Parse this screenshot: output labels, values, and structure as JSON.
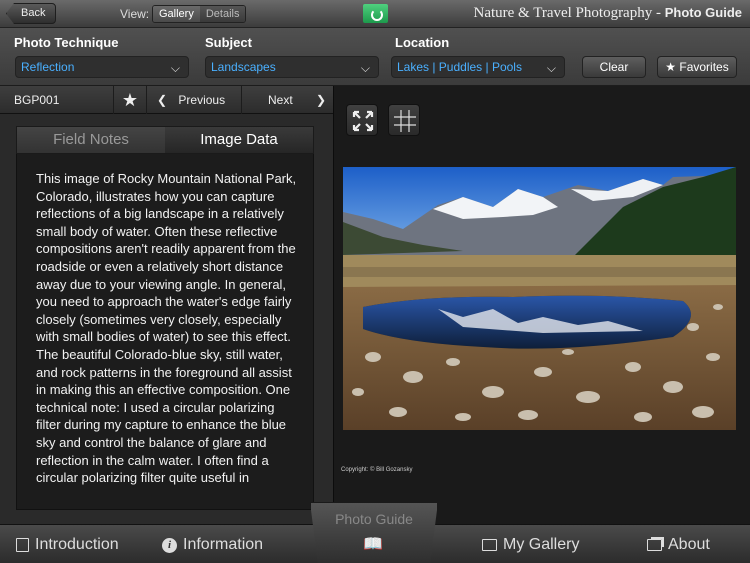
{
  "topbar": {
    "back_label": "Back",
    "view_label": "View:",
    "view_options": [
      "Gallery",
      "Details"
    ],
    "app_title": "Nature & Travel Photography -",
    "app_title_bold": "Photo Guide"
  },
  "filters": {
    "photo_technique": {
      "label": "Photo Technique",
      "value": "Reflection"
    },
    "subject": {
      "label": "Subject",
      "value": "Landscapes"
    },
    "location": {
      "label": "Location",
      "value": "Lakes | Puddles | Pools"
    },
    "clear_label": "Clear",
    "favorites_label": "Favorites"
  },
  "nav": {
    "image_id": "BGP001",
    "previous_label": "Previous",
    "next_label": "Next"
  },
  "tabs": [
    "Field Notes",
    "Image Data"
  ],
  "notes_text": "This image of Rocky Mountain National Park, Colorado, illustrates how you can capture reflections of a big landscape in a relatively small body of water. Often these reflective compositions aren't readily apparent from the roadside or even a relatively short distance away due to your viewing angle. In general, you need to approach the water's edge fairly closely (sometimes very closely, especially with small bodies of water) to see this effect. The beautiful Colorado-blue sky, still water, and rock patterns in the foreground all assist in making this an effective composition. One technical note: I used a circular polarizing filter during my capture to enhance the blue sky and control the balance of glare and reflection in the calm water. I often find a circular polarizing filter quite useful in",
  "copyright": "Copyright: © Bill Gozansky",
  "bottom": {
    "introduction": "Introduction",
    "information": "Information",
    "center": "Photo Guide",
    "my_gallery": "My Gallery",
    "about": "About"
  }
}
